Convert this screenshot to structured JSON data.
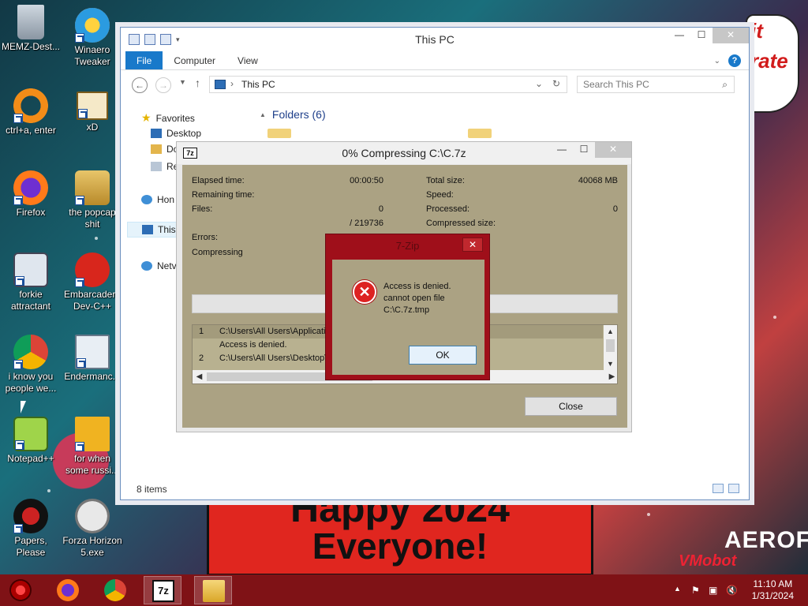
{
  "desktop": {
    "icons": [
      {
        "label": "MEMZ-Dest..."
      },
      {
        "label": "Winaero Tweaker"
      },
      {
        "label": "ctrl+a, enter"
      },
      {
        "label": "xD"
      },
      {
        "label": "Firefox"
      },
      {
        "label": "the popcap shit"
      },
      {
        "label": "forkie attractant"
      },
      {
        "label": "Embarcadero Dev-C++"
      },
      {
        "label": "i know you people we..."
      },
      {
        "label": "Endermanc..."
      },
      {
        "label": "Notepad++"
      },
      {
        "label": "for when some russi..."
      },
      {
        "label": "Papers, Please"
      },
      {
        "label": "Forza Horizon 5.exe"
      }
    ],
    "wallpaper": {
      "banner_line1": "Happy 2024",
      "banner_line2": "Everyone!",
      "cloud_text1": "it",
      "cloud_text2": "rate",
      "corner_text": "AEROFS",
      "watermark": "VMobot"
    }
  },
  "explorer": {
    "title": "This PC",
    "ribbon_tabs": [
      "File",
      "Computer",
      "View"
    ],
    "address": "This PC",
    "search_placeholder": "Search This PC",
    "nav": {
      "favorites": "Favorites",
      "desktop": "Desktop",
      "downloads": "Do",
      "recent": "Re",
      "homegroup": "Hon",
      "thispc": "This",
      "network": "Netv"
    },
    "folders_header": "Folders (6)",
    "status_count": "8 items"
  },
  "zip": {
    "title": "0% Compressing C:\\C.7z",
    "logo": "7z",
    "labels": {
      "elapsed": "Elapsed time:",
      "remaining": "Remaining time:",
      "files": "Files:",
      "errors": "Errors:",
      "compressing": "Compressing",
      "total_size": "Total size:",
      "speed": "Speed:",
      "processed": "Processed:",
      "compressed_size": "Compressed size:"
    },
    "values": {
      "elapsed": "00:00:50",
      "files": "0",
      "files_total": "/ 219736",
      "total_size": "40068 MB",
      "processed": "0"
    },
    "progress": 0,
    "log_rows": [
      {
        "num": "1",
        "text": "C:\\Users\\All Users\\Application"
      },
      {
        "num": "",
        "text": "Access is denied."
      },
      {
        "num": "2",
        "text": "C:\\Users\\All Users\\Desktop\\"
      }
    ],
    "close_label": "Close"
  },
  "error_dialog": {
    "title": "7-Zip",
    "message_line1": "Access is denied.",
    "message_line2": "cannot open file",
    "message_line3": "C:\\C.7z.tmp",
    "ok_label": "OK"
  },
  "taskbar": {
    "time": "11:10 AM",
    "date": "1/31/2024",
    "zip_label": "7z"
  },
  "colors": {
    "taskbar": "#7f1216",
    "dialog_body": "#aba283",
    "error_frame": "#9f0f1a",
    "ribbon_file": "#1979ca"
  }
}
